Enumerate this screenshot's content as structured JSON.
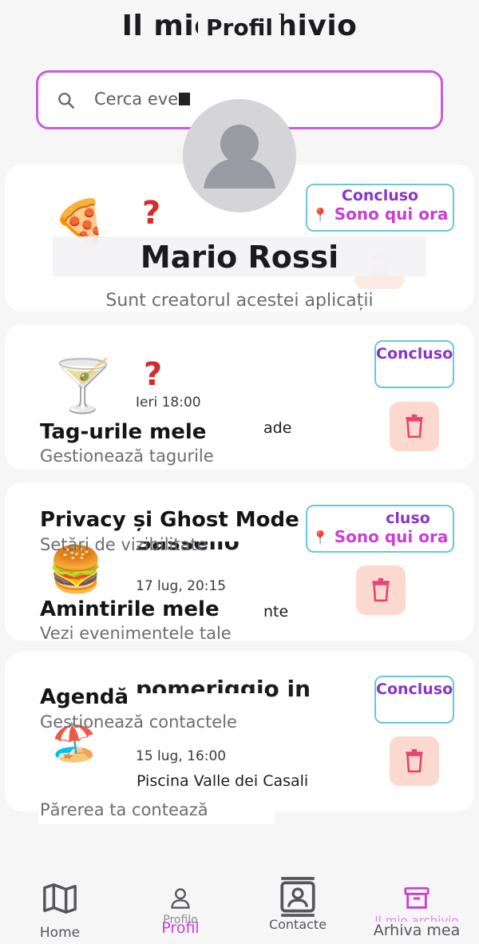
{
  "background_page": {
    "title": "Il mio archivio",
    "search": {
      "placeholder": "Cerca eve"
    },
    "events": [
      {
        "emoji": "🍕",
        "status_top": "Concluso",
        "status_bottom": "Sono qui ora",
        "status_pin": "📍"
      },
      {
        "emoji": "🍸",
        "date": "Ieri 18:00",
        "place_fragment": "ade",
        "status_top": "Concluso"
      },
      {
        "emoji": "🍔",
        "title_fragment": "Sassello",
        "date": "17 lug, 20:15",
        "place_fragment": "nte",
        "status_top": "cluso",
        "status_bottom": "Sono qui ora",
        "status_pin": "📍"
      },
      {
        "emoji": "🏖️",
        "title_fragment": "pomeriggio in",
        "date": "15 lug, 16:00",
        "place": "Piscina Valle dei Casali",
        "status_top": "Concluso"
      }
    ]
  },
  "profile": {
    "title": "Profil",
    "name": "Mario Rossi",
    "bio": "Sunt creatorul acestei aplicații",
    "menu": [
      {
        "title": "Tag-urile mele",
        "subtitle": "Gestionează tagurile"
      },
      {
        "title": "Privacy și Ghost Mode",
        "subtitle": "Setări de vizibilitate"
      },
      {
        "title": "Amintirile mele",
        "subtitle": "Vezi evenimentele tale"
      },
      {
        "title": "Agendă",
        "subtitle": "Gestionează contactele"
      },
      {
        "title": "",
        "subtitle": "Părerea ta contează"
      }
    ]
  },
  "nav": {
    "home": "Home",
    "profile": "Profil",
    "contacts": "Contacte",
    "archive": "Arhiva mea",
    "archive_ghost": "Il mio archivio",
    "profile_ghost": "Profilo"
  },
  "colors": {
    "accent": "#c940d4",
    "status_purple": "#8a35c7",
    "status_border": "#68c8d8",
    "trash_bg": "#fbd9cf",
    "trash_icon": "#e8416e"
  },
  "icons": {
    "search": "search-icon",
    "avatar": "person-icon",
    "trash": "trash-icon",
    "home": "map-icon",
    "profile": "person-icon",
    "contacts": "contacts-icon",
    "archive": "archive-icon"
  }
}
